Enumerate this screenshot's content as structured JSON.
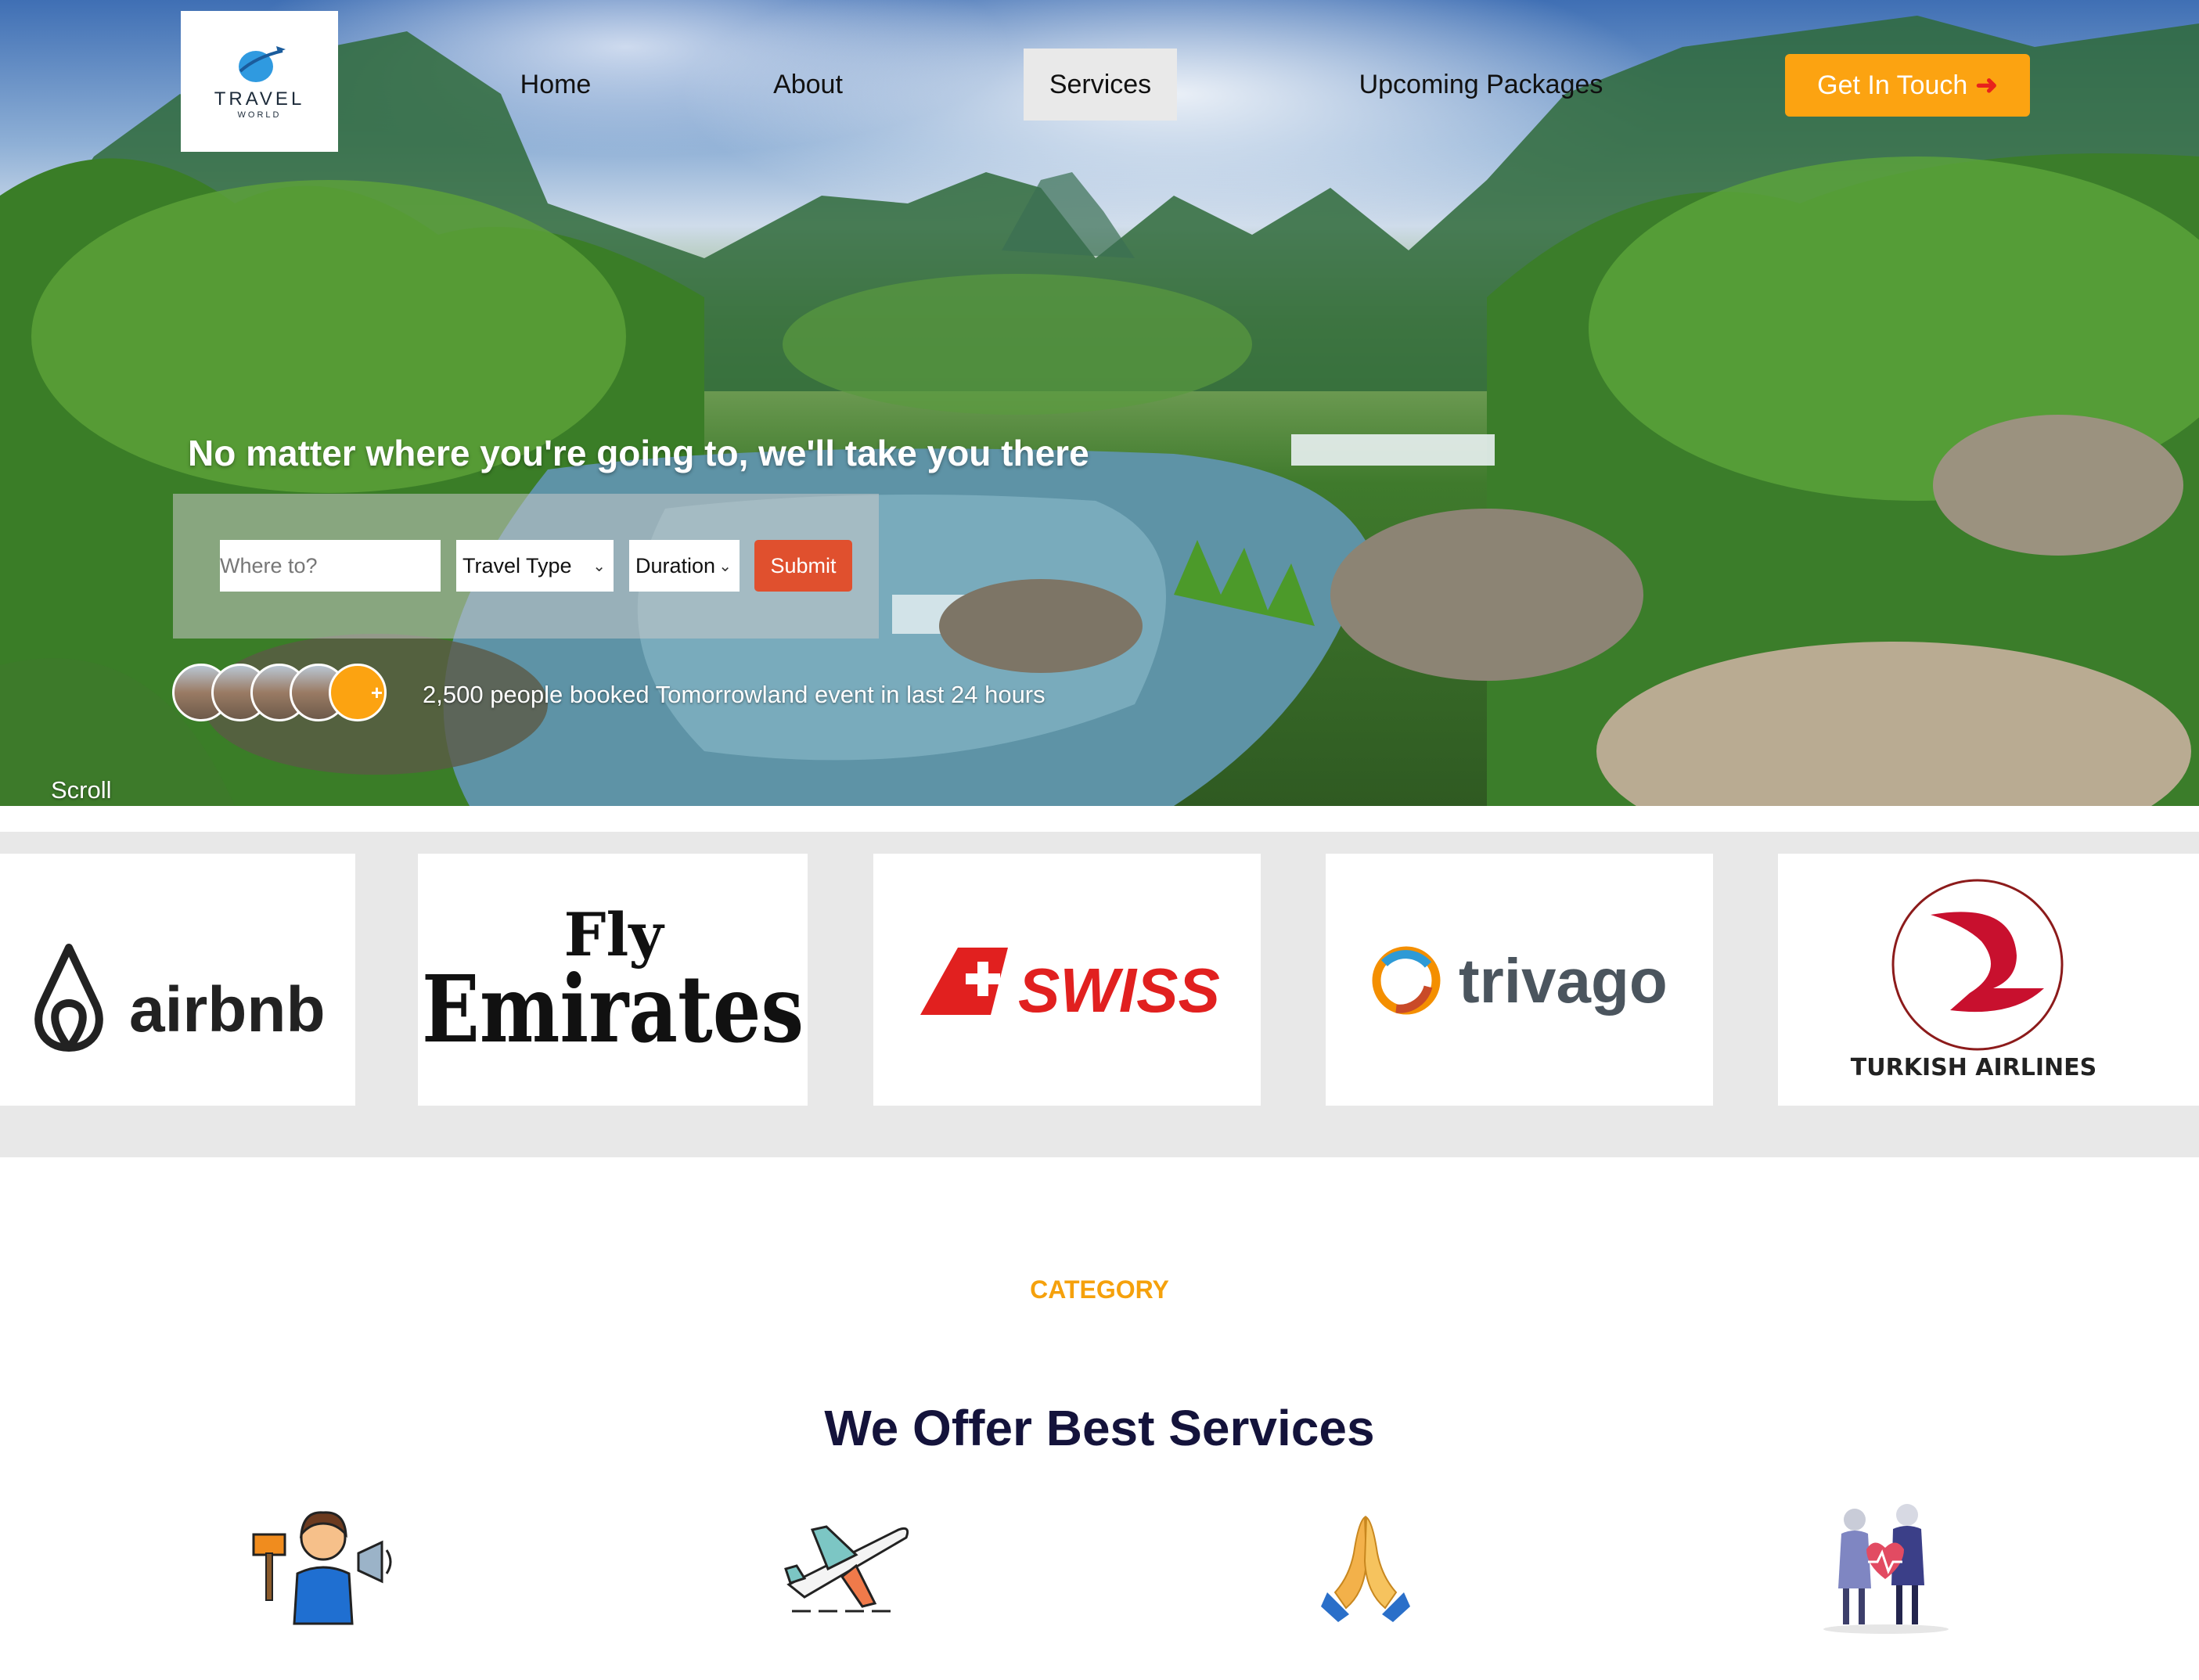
{
  "logo": {
    "line1": "TRAVEL",
    "line2": "WORLD"
  },
  "nav": {
    "items": [
      {
        "label": "Home",
        "active": false
      },
      {
        "label": "About",
        "active": false
      },
      {
        "label": "Services",
        "active": true
      },
      {
        "label": "Upcoming Packages",
        "active": false
      }
    ],
    "cta_label": "Get In Touch",
    "cta_icon": "arrow-right-icon"
  },
  "hero": {
    "headline": "No matter where you're going to, we'll take you there",
    "search": {
      "placeholder": "Where to?",
      "travel_type": "Travel Type",
      "duration": "Duration",
      "submit_label": "Submit"
    },
    "avatar_plus": "+",
    "booked_text": "2,500 people booked Tomorrowland event in last 24 hours",
    "scroll_label": "Scroll"
  },
  "partners": {
    "airbnb": "airbnb",
    "emirates_top": "Fly",
    "emirates_bottom": "Emirates",
    "swiss": "SWISS",
    "trivago": "trivago",
    "turkish": "TURKISH AIRLINES"
  },
  "category": {
    "eyebrow": "CATEGORY",
    "title": "We Offer Best Services",
    "icons": [
      "tour-guide-icon",
      "airplane-icon",
      "praying-hands-icon",
      "elderly-care-icon"
    ]
  },
  "colors": {
    "accent": "#fca311",
    "submit": "#e0502e",
    "title": "#14133b",
    "eyebrow": "#f5a10c"
  }
}
